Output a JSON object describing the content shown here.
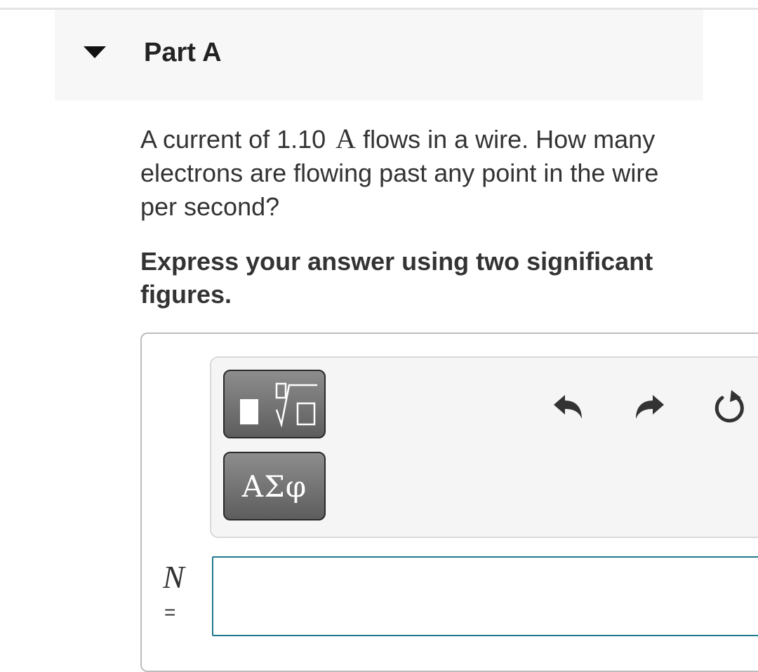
{
  "part": {
    "title": "Part A"
  },
  "question": {
    "text_before": "A current of 1.10",
    "unit": "A",
    "text_after": "flows in a wire. How many electrons are flowing past any point in the wire per second?"
  },
  "instruction": "Express your answer using two significant figures.",
  "toolbar": {
    "templates_icon": "square-root-template-icon",
    "symbols_label": "ΑΣφ",
    "undo_icon": "undo-icon",
    "redo_icon": "redo-icon",
    "reset_icon": "reset-icon"
  },
  "answer": {
    "variable": "N",
    "equals": "=",
    "value": ""
  },
  "colors": {
    "input_border": "#1e7a8c",
    "button_gray": "#6f6f6f",
    "header_bg": "#f7f7f7"
  }
}
